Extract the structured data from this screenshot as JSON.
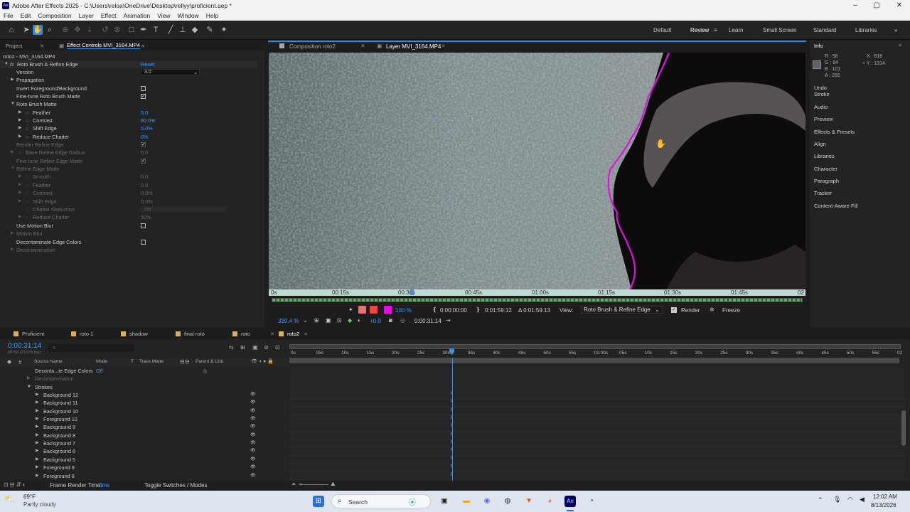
{
  "window": {
    "title": "Adobe After Effects 2025 - C:\\Users\\reloa\\OneDrive\\Desktop\\rellyy\\proficient.aep *",
    "logo": "Ae"
  },
  "menu": [
    "File",
    "Edit",
    "Composition",
    "Layer",
    "Effect",
    "Animation",
    "View",
    "Window",
    "Help"
  ],
  "workspaces": [
    "Default",
    "Review",
    "Learn",
    "Small Screen",
    "Standard",
    "Libraries"
  ],
  "workspace_active": "Review",
  "left_panel": {
    "tabs": [
      "Project",
      "Effect Controls MVI_3164.MP4"
    ],
    "layer_label": "roto2 - MVI_3164.MP4",
    "effect_name": "Roto Brush & Refine Edge",
    "reset": "Reset",
    "fx": "fx",
    "rows": [
      {
        "label": "Version",
        "value": "3.0"
      },
      {
        "label": "Propagation"
      },
      {
        "label": "Invert Foreground/Background"
      },
      {
        "label": "Fine-tune Roto Brush Matte"
      },
      {
        "label": "Roto Brush Matte"
      },
      {
        "label": "Feather",
        "value": "5.0"
      },
      {
        "label": "Contrast",
        "value": "80.0%"
      },
      {
        "label": "Shift Edge",
        "value": "0.0%"
      },
      {
        "label": "Reduce Chatter",
        "value": "0%"
      },
      {
        "label": "Render Refine Edge"
      },
      {
        "label": "Base Refine Edge Radius",
        "value": "0.0"
      },
      {
        "label": "Fine-tune Refine Edge Matte"
      },
      {
        "label": "Refine Edge Matte"
      },
      {
        "label": "Smooth",
        "value": "0.0"
      },
      {
        "label": "Feather",
        "value": "0.0"
      },
      {
        "label": "Contrast",
        "value": "0.0%"
      },
      {
        "label": "Shift Edge",
        "value": "0.0%"
      },
      {
        "label": "Chatter Reduction",
        "value": "Off"
      },
      {
        "label": "Reduce Chatter",
        "value": "50%"
      },
      {
        "label": "Use Motion Blur"
      },
      {
        "label": "Motion Blur"
      },
      {
        "label": "Decontaminate Edge Colors"
      },
      {
        "label": "Decontamination"
      }
    ]
  },
  "viewer": {
    "tabs": [
      "Composition roto2",
      "Layer MVI_3164.MP4"
    ],
    "ruler_ticks": [
      "0s",
      "00:15s",
      "00:30s",
      "00:45s",
      "01:00s",
      "01:15s",
      "01:30s",
      "01:45s",
      "02"
    ],
    "zoom": "320.4 %",
    "resolution": "100 %",
    "exposure": "+0.0",
    "in_time": "0:00:00:00",
    "out_time": "0:01:59:12",
    "duration": "Δ 0:01:59:13",
    "current_time": "0:00:31:14",
    "view_label": "View:",
    "view_value": "Roto Brush & Refine Edge",
    "render_label": "Render",
    "freeze_label": "Freeze"
  },
  "info": {
    "title": "Info",
    "r": "R : 98",
    "g": "G : 94",
    "b": "B : 101",
    "a": "A : 255",
    "x": "X : 818",
    "y": "+ Y : 1314",
    "undo": "Undo",
    "stroke": "Stroke",
    "panels": [
      "Audio",
      "Preview",
      "Effects & Presets",
      "Align",
      "Libraries",
      "Character",
      "Paragraph",
      "Tracker",
      "Content-Aware Fill"
    ]
  },
  "timeline": {
    "tabs": [
      {
        "label": "Proficient",
        "color": "#d8b25a"
      },
      {
        "label": "roto 1",
        "color": "#d8b25a"
      },
      {
        "label": "shadow",
        "color": "#d8b25a"
      },
      {
        "label": "final roto",
        "color": "#d8b25a"
      },
      {
        "label": "roto",
        "color": "#d8b25a"
      },
      {
        "label": "roto2",
        "color": "#d8b25a"
      }
    ],
    "timecode": "0:00:31:14",
    "frame_info": "00758 (23.976 fps)",
    "columns": [
      "Source Name",
      "Mode",
      "T",
      "Track Matte",
      "Parent & Link"
    ],
    "decontam_label": "Deconta...te Edge Colors",
    "decontam_value": "Off",
    "decontamination": "Decontamination",
    "strokes": "Strokes",
    "layers": [
      "Background 12",
      "Background 11",
      "Background 10",
      "Foreground 10",
      "Background 9",
      "Background 8",
      "Background 7",
      "Background 6",
      "Background 5",
      "Foreground 9",
      "Foreground 8"
    ],
    "ruler": [
      "0s",
      "05s",
      "10s",
      "15s",
      "20s",
      "25s",
      "30s",
      "35s",
      "40s",
      "45s",
      "50s",
      "55s",
      "01:00s",
      "05s",
      "10s",
      "15s",
      "20s",
      "25s",
      "30s",
      "35s",
      "40s",
      "45s",
      "50s",
      "55s",
      "02"
    ],
    "frame_render_label": "Frame Render Time:",
    "frame_render_value": "0ms",
    "toggle": "Toggle Switches / Modes"
  },
  "taskbar": {
    "temp": "69°F",
    "weather": "Partly cloudy",
    "search": "Search",
    "time": "12:02 AM",
    "date": "8/13/2026"
  },
  "colors": {
    "accent": "#2d8ceb",
    "roto_stroke": "#e010e0",
    "timecode": "#3b9bff"
  }
}
